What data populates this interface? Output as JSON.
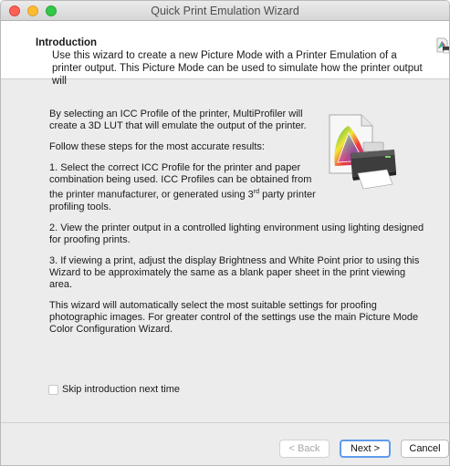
{
  "window": {
    "title": "Quick Print Emulation Wizard"
  },
  "header": {
    "title": "Introduction",
    "description": "Use this wizard to create a new Picture Mode with a Printer Emulation of a printer output. This Picture Mode can be used to simulate how the printer output will"
  },
  "content": {
    "intro": "By selecting an ICC Profile of the printer, MultiProfiler will create a 3D LUT that will emulate the output of the printer.",
    "steps_intro": "Follow these steps for the most accurate results:",
    "step1": "1. Select the correct ICC Profile for the printer and paper combination being used. ICC Profiles can be obtained from the printer manufacturer, or generated using 3",
    "step1_sup": "rd",
    "step1_end": " party printer profiling tools.",
    "step2": "2. View the printer output in a controlled lighting environment using lighting designed for proofing prints.",
    "step3": "3. If viewing a print, adjust the display Brightness and White Point prior to using this Wizard to be approximately the same as a blank paper sheet in the print viewing area.",
    "closing": "This wizard will automatically select the most suitable settings for proofing photographic images. For greater control of the settings use the main Picture Mode Color Configuration Wizard."
  },
  "options": {
    "skip_label": "Skip introduction next time",
    "skip_checked": false
  },
  "buttons": {
    "back": "< Back",
    "next": "Next >",
    "cancel": "Cancel"
  },
  "colors": {
    "close": "#fc5f57",
    "minimize": "#fdbc2e",
    "maximize": "#34c84a",
    "default_button_ring": "#5e9cec"
  },
  "icons": {
    "header": "printer-profile-icon",
    "illustration": "icc-profile-printer-icon"
  }
}
